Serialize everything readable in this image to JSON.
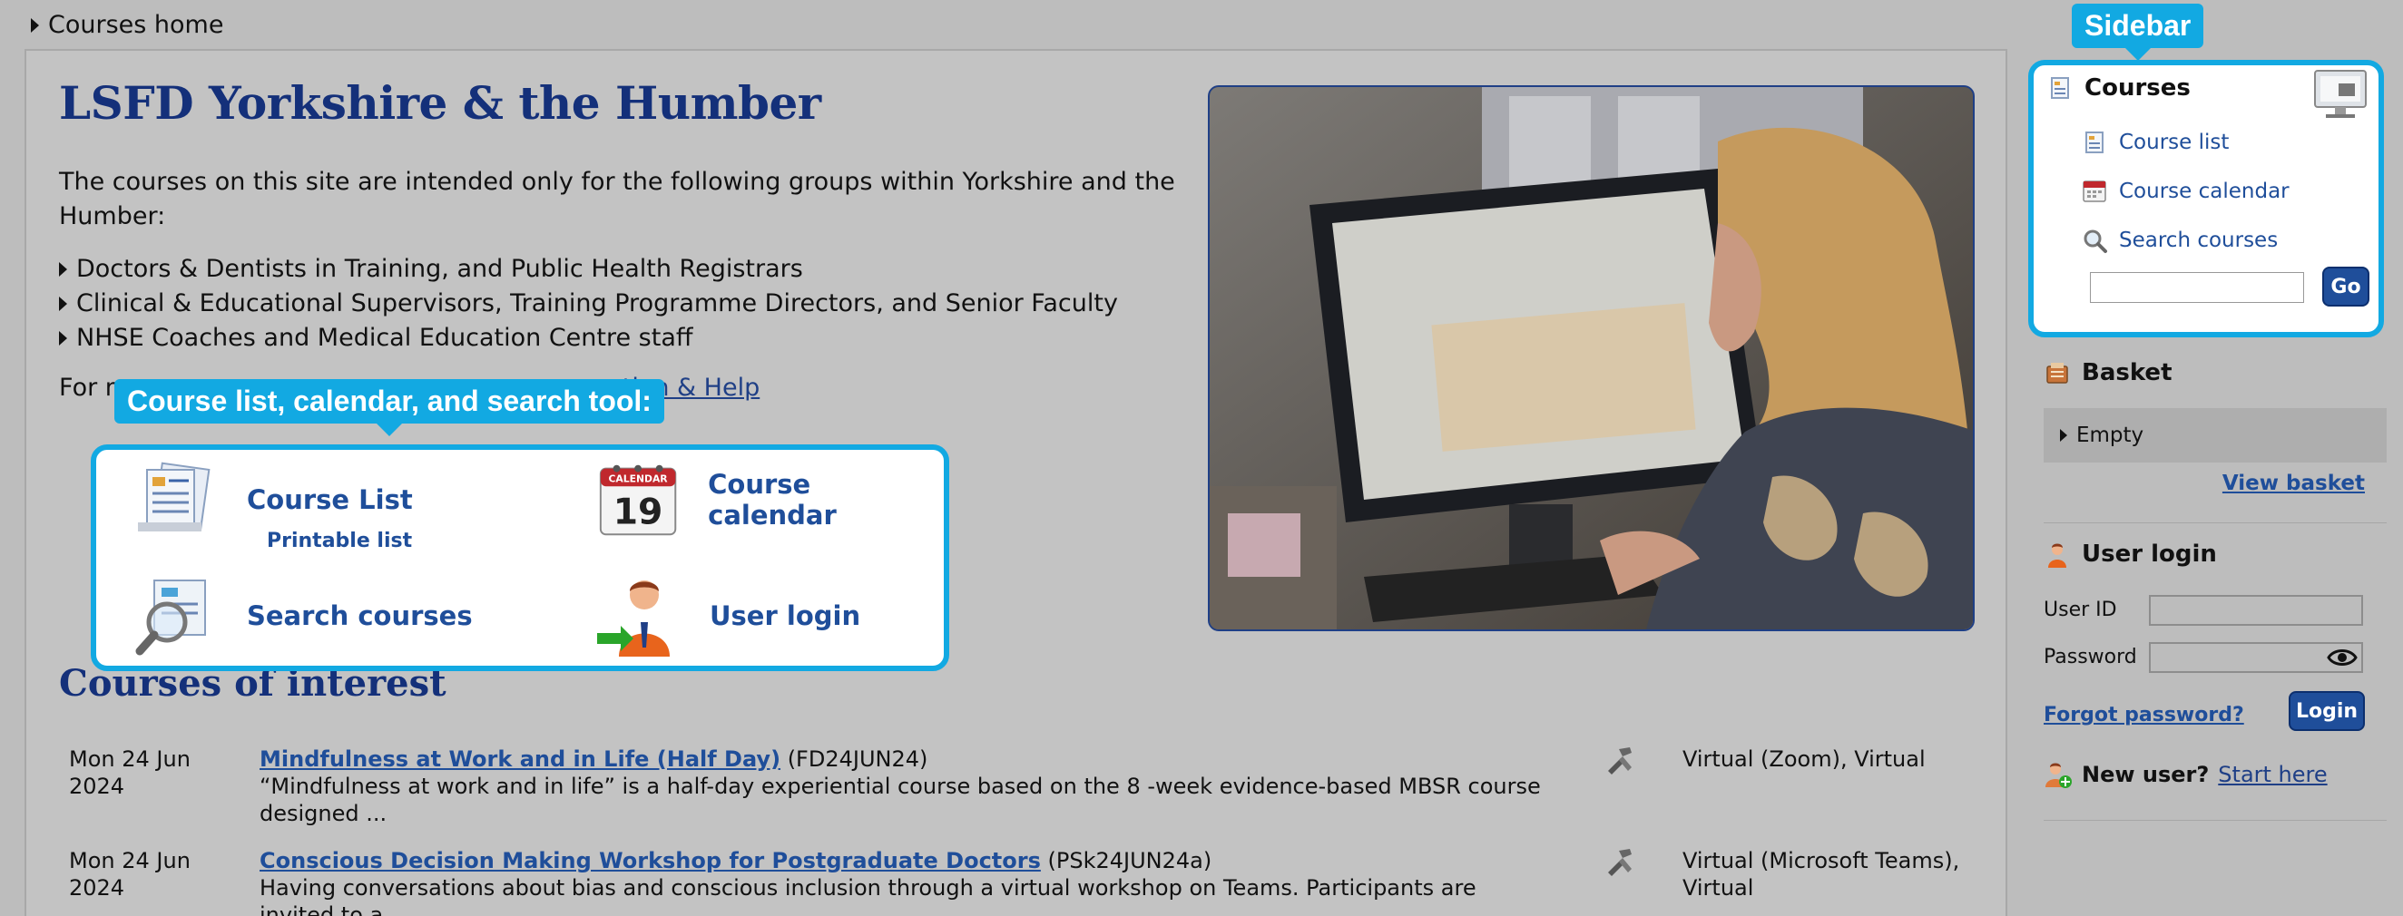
{
  "breadcrumb": {
    "label": "Courses home"
  },
  "main": {
    "title": "LSFD Yorkshire & the Humber",
    "intro": "The courses on this site are intended only for the following groups within Yorkshire and the Humber:",
    "groups": [
      "Doctors & Dentists in Training, and Public Health Registrars",
      "Clinical & Educational Supervisors, Training Programme Directors, and Senior Faculty",
      "NHSE Coaches and Medical Education Centre staff"
    ],
    "more_info_prefix": "For m",
    "more_info_link": "nation & Help"
  },
  "callouts": {
    "features": "Course list, calendar, and search tool:",
    "sidebar": "Sidebar"
  },
  "features": {
    "course_list": "Course List",
    "printable_list": "Printable list",
    "course_calendar": "Course calendar",
    "search_courses": "Search courses",
    "user_login": "User login",
    "calendar_header": "CALENDAR",
    "calendar_day": "19"
  },
  "courses_of_interest": {
    "title": "Courses of interest",
    "rows": [
      {
        "date_line1": "Mon 24 Jun",
        "date_line2": "2024",
        "title": "Mindfulness at Work and in Life (Half Day)",
        "code": "(FD24JUN24)",
        "desc": "“Mindfulness at work and in life” is a half-day experiential course based on the 8 -week evidence-based MBSR course designed ...",
        "location": "Virtual (Zoom), Virtual"
      },
      {
        "date_line1": "Mon 24 Jun",
        "date_line2": "2024",
        "title": "Conscious Decision Making Workshop for Postgraduate Doctors",
        "code": "(PSk24JUN24a)",
        "desc": "Having conversations about bias and conscious inclusion through a virtual workshop on Teams. Participants are invited to a ...",
        "location": "Virtual (Microsoft Teams), Virtual"
      }
    ]
  },
  "sidebar": {
    "courses_title": "Courses",
    "course_list": "Course list",
    "course_calendar": "Course calendar",
    "search_courses": "Search courses",
    "search_placeholder": "",
    "go": "Go",
    "basket_title": "Basket",
    "basket_empty": "Empty",
    "view_basket": "View basket",
    "login_title": "User login",
    "user_id_label": "User ID",
    "password_label": "Password",
    "forgot_password": "Forgot password?",
    "login_button": "Login",
    "new_user_label": "New user?",
    "start_here": "Start here"
  },
  "colors": {
    "accent_callout": "#12a9e2",
    "link_blue": "#1f4e9a",
    "title_navy": "#14307a"
  }
}
